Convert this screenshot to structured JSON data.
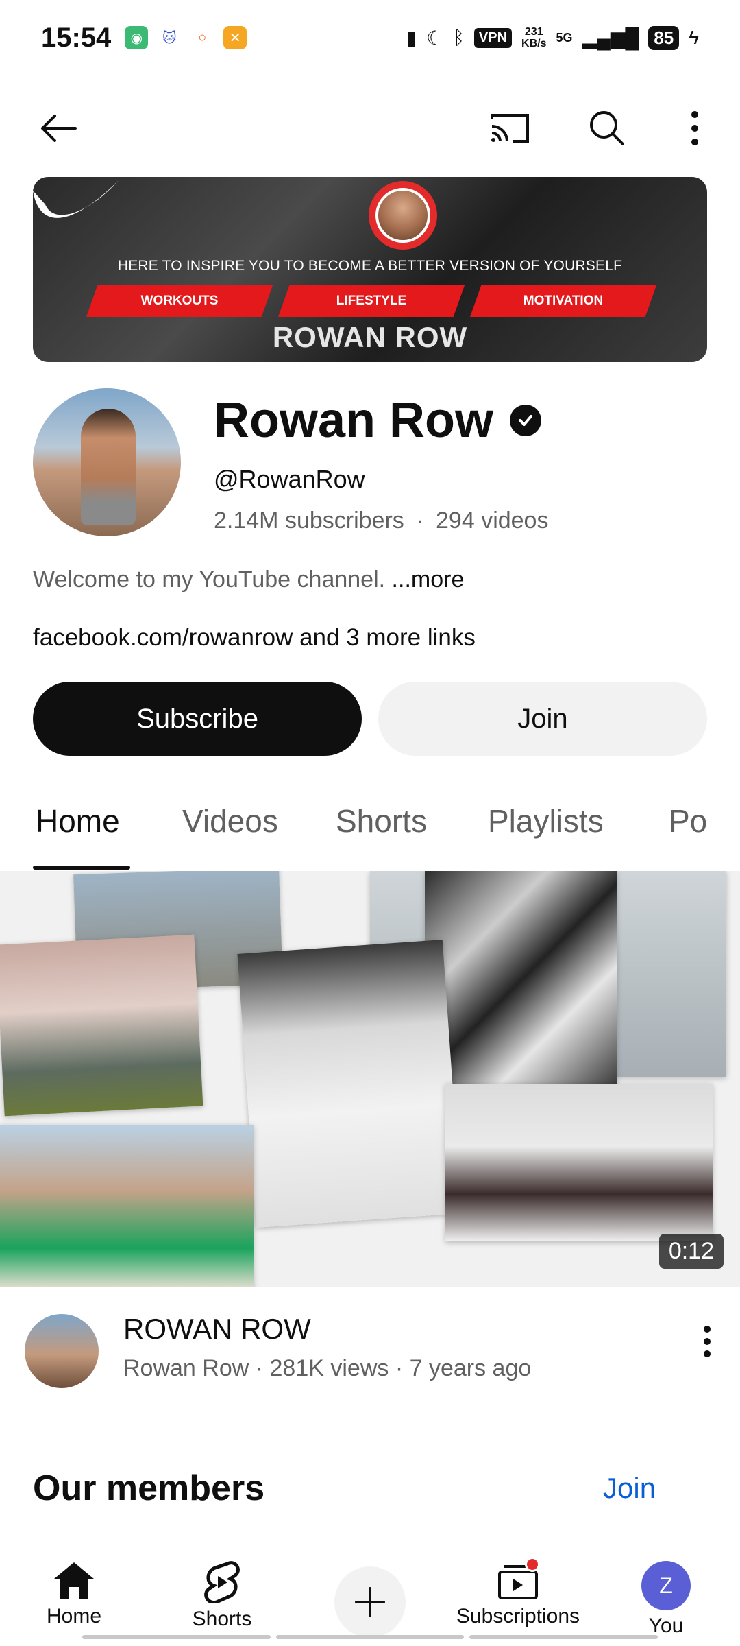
{
  "status_bar": {
    "time": "15:54",
    "vpn": "VPN",
    "speed_value": "231",
    "speed_unit": "KB/s",
    "network": "5G",
    "battery": "85"
  },
  "banner": {
    "tagline": "HERE TO INSPIRE YOU TO BECOME A BETTER VERSION OF YOURSELF",
    "pills": [
      "WORKOUTS",
      "LIFESTYLE",
      "MOTIVATION"
    ],
    "name": "ROWAN ROW"
  },
  "channel": {
    "name": "Rowan Row",
    "handle": "@RowanRow",
    "subscribers": "2.14M subscribers",
    "separator": "·",
    "videos": "294 videos",
    "description": "Welcome to my YouTube channel.",
    "more": "...more",
    "links": "facebook.com/rowanrow and 3 more links",
    "subscribe_label": "Subscribe",
    "join_label": "Join"
  },
  "tabs": [
    "Home",
    "Videos",
    "Shorts",
    "Playlists",
    "Po"
  ],
  "video": {
    "duration": "0:12",
    "title": "ROWAN ROW",
    "meta": "Rowan Row · 281K views · 7 years ago"
  },
  "members": {
    "title": "Our members",
    "join": "Join"
  },
  "bottom_nav": {
    "home": "Home",
    "shorts": "Shorts",
    "subscriptions": "Subscriptions",
    "you": "You",
    "avatar_letter": "Z"
  },
  "colors": {
    "accent_red": "#e32b2b",
    "link_blue": "#065fd4",
    "avatar_purple": "#5b5fd6"
  }
}
